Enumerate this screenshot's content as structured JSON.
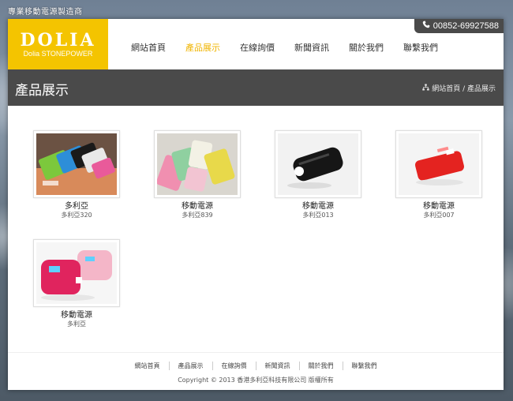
{
  "header": {
    "top_tagline": "專業移動電源製造商",
    "logo_main": "DOLIA",
    "logo_sub": "Dolia STONEPOWER",
    "phone": "00852-69927588"
  },
  "nav": {
    "items": [
      {
        "label": "網站首頁",
        "active": false
      },
      {
        "label": "產品展示",
        "active": true
      },
      {
        "label": "在線詢價",
        "active": false
      },
      {
        "label": "新聞資訊",
        "active": false
      },
      {
        "label": "關於我們",
        "active": false
      },
      {
        "label": "聯繫我們",
        "active": false
      }
    ]
  },
  "banner": {
    "title": "產品展示",
    "breadcrumb": "網站首頁 / 產品展示"
  },
  "products": [
    {
      "name": "多利亞",
      "code": "多利亞320"
    },
    {
      "name": "移動電源",
      "code": "多利亞839"
    },
    {
      "name": "移動電源",
      "code": "多利亞013"
    },
    {
      "name": "移動電源",
      "code": "多利亞007"
    },
    {
      "name": "移動電源",
      "code": "多利亞"
    }
  ],
  "footer": {
    "links": [
      "網站首頁",
      "產品展示",
      "在線詢價",
      "新聞資訊",
      "關於我們",
      "聯繫我們"
    ],
    "copyright": "Copyright © 2013 香港多利亞科技有限公司 版權所有"
  },
  "colors": {
    "brand_yellow": "#f4c400",
    "active_nav": "#f0b400",
    "banner_gray": "#4a4a4a"
  },
  "icons": {
    "phone": "phone-icon",
    "breadcrumb": "sitemap-icon"
  }
}
